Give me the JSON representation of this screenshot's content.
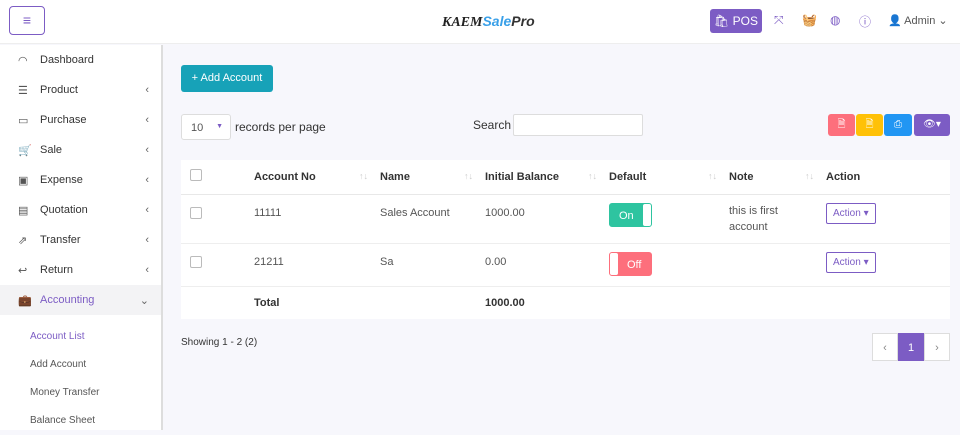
{
  "header": {
    "logo": "KAEMSalePro",
    "pos_label": "POS",
    "user": "Admin"
  },
  "sidebar": {
    "items": [
      {
        "label": "Dashboard",
        "icon": "gauge-icon"
      },
      {
        "label": "Product",
        "icon": "list-icon"
      },
      {
        "label": "Purchase",
        "icon": "card-icon"
      },
      {
        "label": "Sale",
        "icon": "cart-icon"
      },
      {
        "label": "Expense",
        "icon": "wallet-icon"
      },
      {
        "label": "Quotation",
        "icon": "doc-icon"
      },
      {
        "label": "Transfer",
        "icon": "share-icon"
      },
      {
        "label": "Return",
        "icon": "undo-icon"
      },
      {
        "label": "Accounting",
        "icon": "briefcase-icon"
      }
    ],
    "subitems": [
      "Account List",
      "Add Account",
      "Money Transfer",
      "Balance Sheet"
    ]
  },
  "main": {
    "add_label": "+ Add Account",
    "page_size": "10",
    "records_label": "records per page",
    "search_label": "Search",
    "search_value": "",
    "columns": [
      "Account No",
      "Name",
      "Initial Balance",
      "Default",
      "Note",
      "Action"
    ],
    "rows": [
      {
        "account_no": "11111",
        "name": "Sales Account",
        "balance": "1000.00",
        "default": "On",
        "note": "this is first account",
        "action": "Action"
      },
      {
        "account_no": "21211",
        "name": "Sa",
        "balance": "0.00",
        "default": "Off",
        "note": "",
        "action": "Action"
      }
    ],
    "total_label": "Total",
    "total_value": "1000.00",
    "showing": "Showing 1 - 2 (2)",
    "current_page": "1"
  },
  "colors": {
    "accent": "#7c5cc4",
    "teal": "#17a2b8",
    "on": "#2ec4a0",
    "off": "#fd6f7c"
  }
}
